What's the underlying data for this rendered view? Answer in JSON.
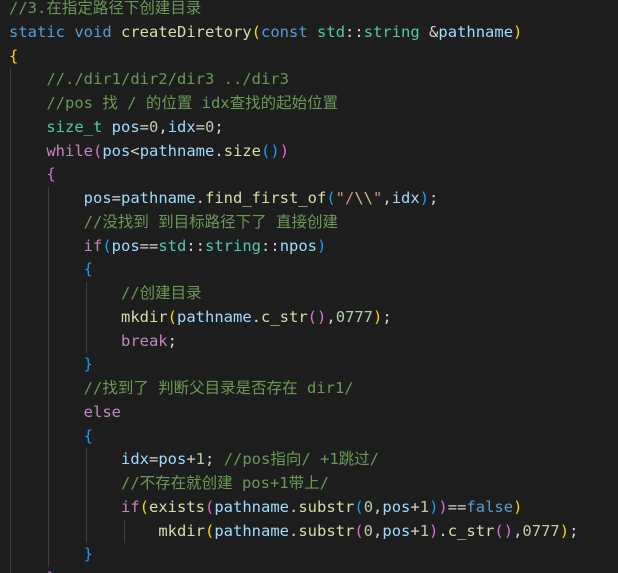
{
  "editor": {
    "theme_colors": {
      "background": "#1e1e1e",
      "comment": "#6a9955",
      "keyword": "#569cd6",
      "control": "#c586c0",
      "type": "#4ec9b0",
      "function": "#dcdcaa",
      "variable": "#9cdcfe",
      "number": "#b5cea8",
      "string": "#ce9178",
      "escape": "#d7ba7d",
      "bracket_level_1": "#ffd700",
      "bracket_level_2": "#da70d6",
      "bracket_level_3": "#179fff",
      "indent_guide": "#404040"
    },
    "lines": [
      {
        "indent": 0,
        "tokens": [
          [
            "comment",
            "//3.在指定路径下创建目录"
          ]
        ]
      },
      {
        "indent": 0,
        "tokens": [
          [
            "keyword",
            "static"
          ],
          [
            "op",
            " "
          ],
          [
            "keyword",
            "void"
          ],
          [
            "op",
            " "
          ],
          [
            "func",
            "createDiretory"
          ],
          [
            "b1",
            "("
          ],
          [
            "keyword",
            "const"
          ],
          [
            "op",
            " "
          ],
          [
            "type",
            "std"
          ],
          [
            "op",
            "::"
          ],
          [
            "type",
            "string"
          ],
          [
            "op",
            " &"
          ],
          [
            "var",
            "pathname"
          ],
          [
            "b1",
            ")"
          ]
        ]
      },
      {
        "indent": 0,
        "tokens": [
          [
            "b1",
            "{"
          ]
        ]
      },
      {
        "indent": 1,
        "tokens": [
          [
            "comment",
            "//./dir1/dir2/dir3 ../dir3"
          ]
        ]
      },
      {
        "indent": 1,
        "tokens": [
          [
            "comment",
            "//pos 找 / 的位置 idx查找的起始位置"
          ]
        ]
      },
      {
        "indent": 1,
        "tokens": [
          [
            "type",
            "size_t"
          ],
          [
            "op",
            " "
          ],
          [
            "var",
            "pos"
          ],
          [
            "op",
            "="
          ],
          [
            "num",
            "0"
          ],
          [
            "op",
            ","
          ],
          [
            "var",
            "idx"
          ],
          [
            "op",
            "="
          ],
          [
            "num",
            "0"
          ],
          [
            "op",
            ";"
          ]
        ]
      },
      {
        "indent": 1,
        "tokens": [
          [
            "control",
            "while"
          ],
          [
            "b2",
            "("
          ],
          [
            "var",
            "pos"
          ],
          [
            "op",
            "<"
          ],
          [
            "var",
            "pathname"
          ],
          [
            "op",
            "."
          ],
          [
            "func",
            "size"
          ],
          [
            "b3",
            "()"
          ],
          [
            "b2",
            ")"
          ]
        ]
      },
      {
        "indent": 1,
        "tokens": [
          [
            "b2",
            "{"
          ]
        ]
      },
      {
        "indent": 2,
        "tokens": [
          [
            "var",
            "pos"
          ],
          [
            "op",
            "="
          ],
          [
            "var",
            "pathname"
          ],
          [
            "op",
            "."
          ],
          [
            "func",
            "find_first_of"
          ],
          [
            "b3",
            "("
          ],
          [
            "str",
            "\"/"
          ],
          [
            "esc",
            "\\\\"
          ],
          [
            "str",
            "\""
          ],
          [
            "op",
            ","
          ],
          [
            "var",
            "idx"
          ],
          [
            "b3",
            ")"
          ],
          [
            "op",
            ";"
          ]
        ]
      },
      {
        "indent": 2,
        "tokens": [
          [
            "comment",
            "//没找到 到目标路径下了 直接创建"
          ]
        ]
      },
      {
        "indent": 2,
        "tokens": [
          [
            "control",
            "if"
          ],
          [
            "b3",
            "("
          ],
          [
            "var",
            "pos"
          ],
          [
            "op",
            "=="
          ],
          [
            "type",
            "std"
          ],
          [
            "op",
            "::"
          ],
          [
            "type",
            "string"
          ],
          [
            "op",
            "::"
          ],
          [
            "var",
            "npos"
          ],
          [
            "b3",
            ")"
          ]
        ]
      },
      {
        "indent": 2,
        "tokens": [
          [
            "b3",
            "{"
          ]
        ]
      },
      {
        "indent": 3,
        "tokens": [
          [
            "comment",
            "//创建目录"
          ]
        ]
      },
      {
        "indent": 3,
        "tokens": [
          [
            "func",
            "mkdir"
          ],
          [
            "b1",
            "("
          ],
          [
            "var",
            "pathname"
          ],
          [
            "op",
            "."
          ],
          [
            "func",
            "c_str"
          ],
          [
            "b2",
            "()"
          ],
          [
            "op",
            ","
          ],
          [
            "num",
            "0777"
          ],
          [
            "b1",
            ")"
          ],
          [
            "op",
            ";"
          ]
        ]
      },
      {
        "indent": 3,
        "tokens": [
          [
            "control",
            "break"
          ],
          [
            "op",
            ";"
          ]
        ]
      },
      {
        "indent": 2,
        "tokens": [
          [
            "b3",
            "}"
          ]
        ]
      },
      {
        "indent": 2,
        "tokens": [
          [
            "comment",
            "//找到了 判断父目录是否存在 dir1/"
          ]
        ]
      },
      {
        "indent": 2,
        "tokens": [
          [
            "control",
            "else"
          ]
        ]
      },
      {
        "indent": 2,
        "tokens": [
          [
            "b3",
            "{"
          ]
        ]
      },
      {
        "indent": 3,
        "tokens": [
          [
            "var",
            "idx"
          ],
          [
            "op",
            "="
          ],
          [
            "var",
            "pos"
          ],
          [
            "op",
            "+"
          ],
          [
            "num",
            "1"
          ],
          [
            "op",
            "; "
          ],
          [
            "comment",
            "//pos指向/ +1跳过/"
          ]
        ]
      },
      {
        "indent": 3,
        "tokens": [
          [
            "comment",
            "//不存在就创建 pos+1带上/"
          ]
        ]
      },
      {
        "indent": 3,
        "tokens": [
          [
            "control",
            "if"
          ],
          [
            "b1",
            "("
          ],
          [
            "func",
            "exists"
          ],
          [
            "b2",
            "("
          ],
          [
            "var",
            "pathname"
          ],
          [
            "op",
            "."
          ],
          [
            "func",
            "substr"
          ],
          [
            "b3",
            "("
          ],
          [
            "num",
            "0"
          ],
          [
            "op",
            ","
          ],
          [
            "var",
            "pos"
          ],
          [
            "op",
            "+"
          ],
          [
            "num",
            "1"
          ],
          [
            "b3",
            ")"
          ],
          [
            "b2",
            ")"
          ],
          [
            "op",
            "=="
          ],
          [
            "keyword",
            "false"
          ],
          [
            "b1",
            ")"
          ]
        ]
      },
      {
        "indent": 4,
        "tokens": [
          [
            "func",
            "mkdir"
          ],
          [
            "b1",
            "("
          ],
          [
            "var",
            "pathname"
          ],
          [
            "op",
            "."
          ],
          [
            "func",
            "substr"
          ],
          [
            "b2",
            "("
          ],
          [
            "num",
            "0"
          ],
          [
            "op",
            ","
          ],
          [
            "var",
            "pos"
          ],
          [
            "op",
            "+"
          ],
          [
            "num",
            "1"
          ],
          [
            "b2",
            ")"
          ],
          [
            "op",
            "."
          ],
          [
            "func",
            "c_str"
          ],
          [
            "b2",
            "()"
          ],
          [
            "op",
            ","
          ],
          [
            "num",
            "0777"
          ],
          [
            "b1",
            ")"
          ],
          [
            "op",
            ";"
          ]
        ]
      },
      {
        "indent": 2,
        "tokens": [
          [
            "b3",
            "}"
          ]
        ]
      },
      {
        "indent": 1,
        "tokens": [
          [
            "b2",
            "}"
          ]
        ]
      }
    ]
  }
}
